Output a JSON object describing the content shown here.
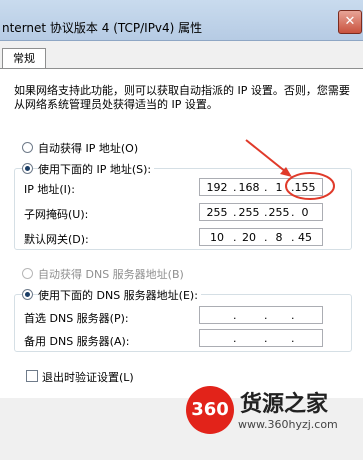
{
  "window": {
    "title": "nternet 协议版本 4 (TCP/IPv4) 属性"
  },
  "tabs": [
    {
      "label": "常规"
    }
  ],
  "description": "如果网络支持此功能，则可以获取自动指派的 IP 设置。否则，您需要从网络系统管理员处获得适当的 IP 设置。",
  "ip_section": {
    "auto_option": "自动获得 IP 地址(O)",
    "manual_option": "使用下面的 IP 地址(S):",
    "selected": "manual",
    "ip_label": "IP 地址(I):",
    "subnet_label": "子网掩码(U):",
    "gateway_label": "默认网关(D):",
    "ip_octets": [
      "192",
      "168",
      "1",
      "155"
    ],
    "subnet_octets": [
      "255",
      "255",
      "255",
      "0"
    ],
    "gateway_octets": [
      "10",
      "20",
      "8",
      "45"
    ]
  },
  "dns_section": {
    "auto_option": "自动获得 DNS 服务器地址(B)",
    "manual_option": "使用下面的 DNS 服务器地址(E):",
    "selected": "manual",
    "preferred_label": "首选 DNS 服务器(P):",
    "alternate_label": "备用 DNS 服务器(A):"
  },
  "validate_on_exit": {
    "label": "退出时验证设置(L)",
    "checked": false
  },
  "watermark": {
    "logo": "360",
    "title": "货源之家",
    "url": "www.360hyzj.com"
  },
  "colors": {
    "annotation": "#e03a2a",
    "title_bar": "#c9dbee",
    "logo": "#e2231a"
  }
}
